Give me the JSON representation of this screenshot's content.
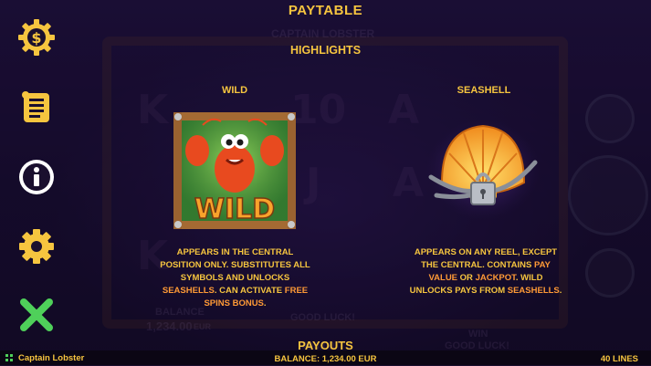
{
  "title": "PAYTABLE",
  "section_title": "HIGHLIGHTS",
  "menu": {
    "items": [
      {
        "icon": "dollar-coin-icon"
      },
      {
        "icon": "scroll-icon"
      },
      {
        "icon": "info-icon"
      },
      {
        "icon": "gear-icon"
      },
      {
        "icon": "close-icon"
      }
    ]
  },
  "symbols": {
    "wild": {
      "title": "WILD",
      "art_text": "WILD",
      "desc_1": "APPEARS IN THE CENTRAL",
      "desc_2": "POSITION ONLY. SUBSTITUTES ALL",
      "desc_3": "SYMBOLS AND UNLOCKS",
      "desc_4a": "SEASHELLS",
      "desc_4b": ". CAN ACTIVATE ",
      "desc_4c": "FREE",
      "desc_5a": "SPINS BONUS",
      "desc_5b": "."
    },
    "seashell": {
      "title": "SEASHELL",
      "desc_1": "APPEARS ON ANY REEL, EXCEPT",
      "desc_2a": "THE CENTRAL. CONTAINS ",
      "desc_2b": "PAY",
      "desc_3a": "VALUE",
      "desc_3b": " OR ",
      "desc_3c": "JACKPOT",
      "desc_3d": ". WILD",
      "desc_4a": "UNLOCKS PAYS FROM ",
      "desc_4b": "SEASHELLS",
      "desc_4c": "."
    }
  },
  "footer_section": "PAYOUTS",
  "background_ui": {
    "balance_label": "BALANCE",
    "balance_value": "1,234.00",
    "currency": "EUR",
    "win_label": "WIN",
    "good_luck": "GOOD LUCK!",
    "bet_value": "400.00",
    "logo": "CAPTAIN LOBSTER"
  },
  "status_bar": {
    "game_name": "Captain Lobster",
    "balance_text": "BALANCE: 1,234.00 EUR",
    "lines_text": "40 LINES"
  },
  "colors": {
    "accent": "#f6c53f",
    "highlight": "#ff9a36",
    "close_green": "#4fd05a",
    "background": "#1a0f2e"
  }
}
